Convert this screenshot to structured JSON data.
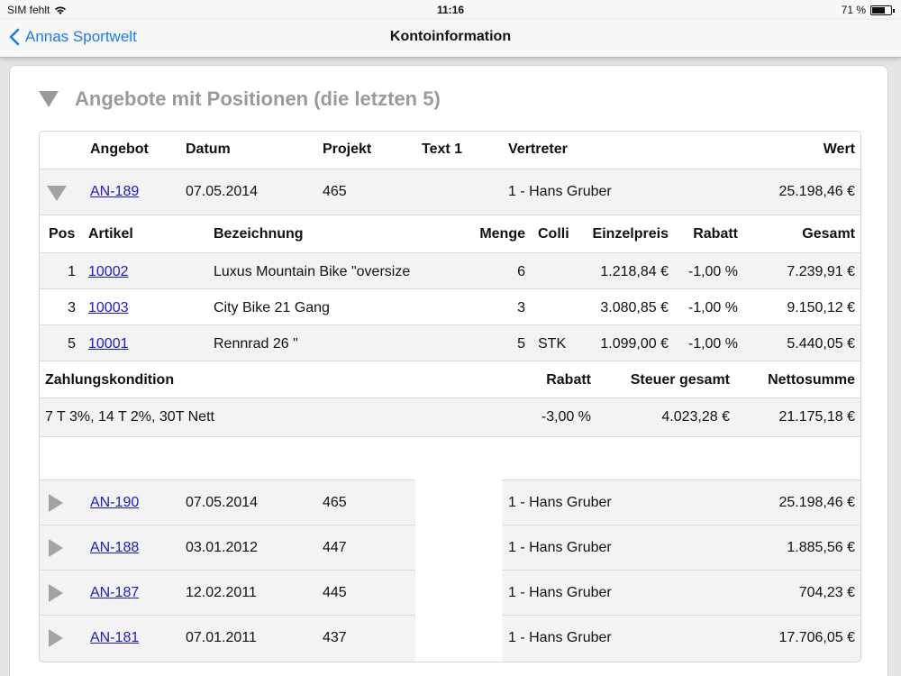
{
  "status_bar": {
    "carrier": "SIM fehlt",
    "time": "11:16",
    "battery_text": "71 %",
    "battery_level": 0.71
  },
  "nav": {
    "back_label": "Annas Sportwelt",
    "title": "Kontoinformation"
  },
  "section": {
    "title": "Angebote mit Positionen (die letzten 5)"
  },
  "offers_header": {
    "angebot": "Angebot",
    "datum": "Datum",
    "projekt": "Projekt",
    "text1": "Text 1",
    "vertreter": "Vertreter",
    "wert": "Wert"
  },
  "offers": [
    {
      "id": "AN-189",
      "date": "07.05.2014",
      "project": "465",
      "text1": "",
      "rep": "1 - Hans Gruber",
      "value": "25.198,46 €",
      "expanded": true
    },
    {
      "id": "AN-190",
      "date": "07.05.2014",
      "project": "465",
      "text1": "",
      "rep": "1 - Hans Gruber",
      "value": "25.198,46 €",
      "expanded": false
    },
    {
      "id": "AN-188",
      "date": "03.01.2012",
      "project": "447",
      "text1": "",
      "rep": "1 - Hans Gruber",
      "value": "1.885,56 €",
      "expanded": false
    },
    {
      "id": "AN-187",
      "date": "12.02.2011",
      "project": "445",
      "text1": "",
      "rep": "1 - Hans Gruber",
      "value": "704,23 €",
      "expanded": false
    },
    {
      "id": "AN-181",
      "date": "07.01.2011",
      "project": "437",
      "text1": "",
      "rep": "1 - Hans Gruber",
      "value": "17.706,05 €",
      "expanded": false
    }
  ],
  "positions_header": {
    "pos": "Pos",
    "artikel": "Artikel",
    "bezeichnung": "Bezeichnung",
    "menge": "Menge",
    "colli": "Colli",
    "einzelpreis": "Einzelpreis",
    "rabatt": "Rabatt",
    "gesamt": "Gesamt"
  },
  "positions": [
    {
      "pos": "1",
      "artikel": "10002",
      "bezeichnung": "Luxus Mountain Bike \"oversize",
      "menge": "6",
      "colli": "",
      "einzelpreis": "1.218,84 €",
      "rabatt": "-1,00 %",
      "gesamt": "7.239,91 €"
    },
    {
      "pos": "3",
      "artikel": "10003",
      "bezeichnung": "City Bike 21 Gang",
      "menge": "3",
      "colli": "",
      "einzelpreis": "3.080,85 €",
      "rabatt": "-1,00 %",
      "gesamt": "9.150,12 €"
    },
    {
      "pos": "5",
      "artikel": "10001",
      "bezeichnung": "Rennrad 26 \"",
      "menge": "5",
      "colli": "STK",
      "einzelpreis": "1.099,00 €",
      "rabatt": "-1,00 %",
      "gesamt": "5.440,05 €"
    }
  ],
  "summary_header": {
    "zahlungskondition": "Zahlungskondition",
    "rabatt": "Rabatt",
    "steuer": "Steuer gesamt",
    "netto": "Nettosumme"
  },
  "summary": {
    "zahlungskondition": "7 T 3%, 14 T 2%, 30T Nett",
    "rabatt": "-3,00 %",
    "steuer": "4.023,28 €",
    "netto": "21.175,18 €"
  },
  "colors": {
    "link": "#1a1ad6",
    "ios_blue": "#1a7cf0",
    "section_title": "#9a9a9a",
    "row_alt": "#f3f3f3"
  }
}
